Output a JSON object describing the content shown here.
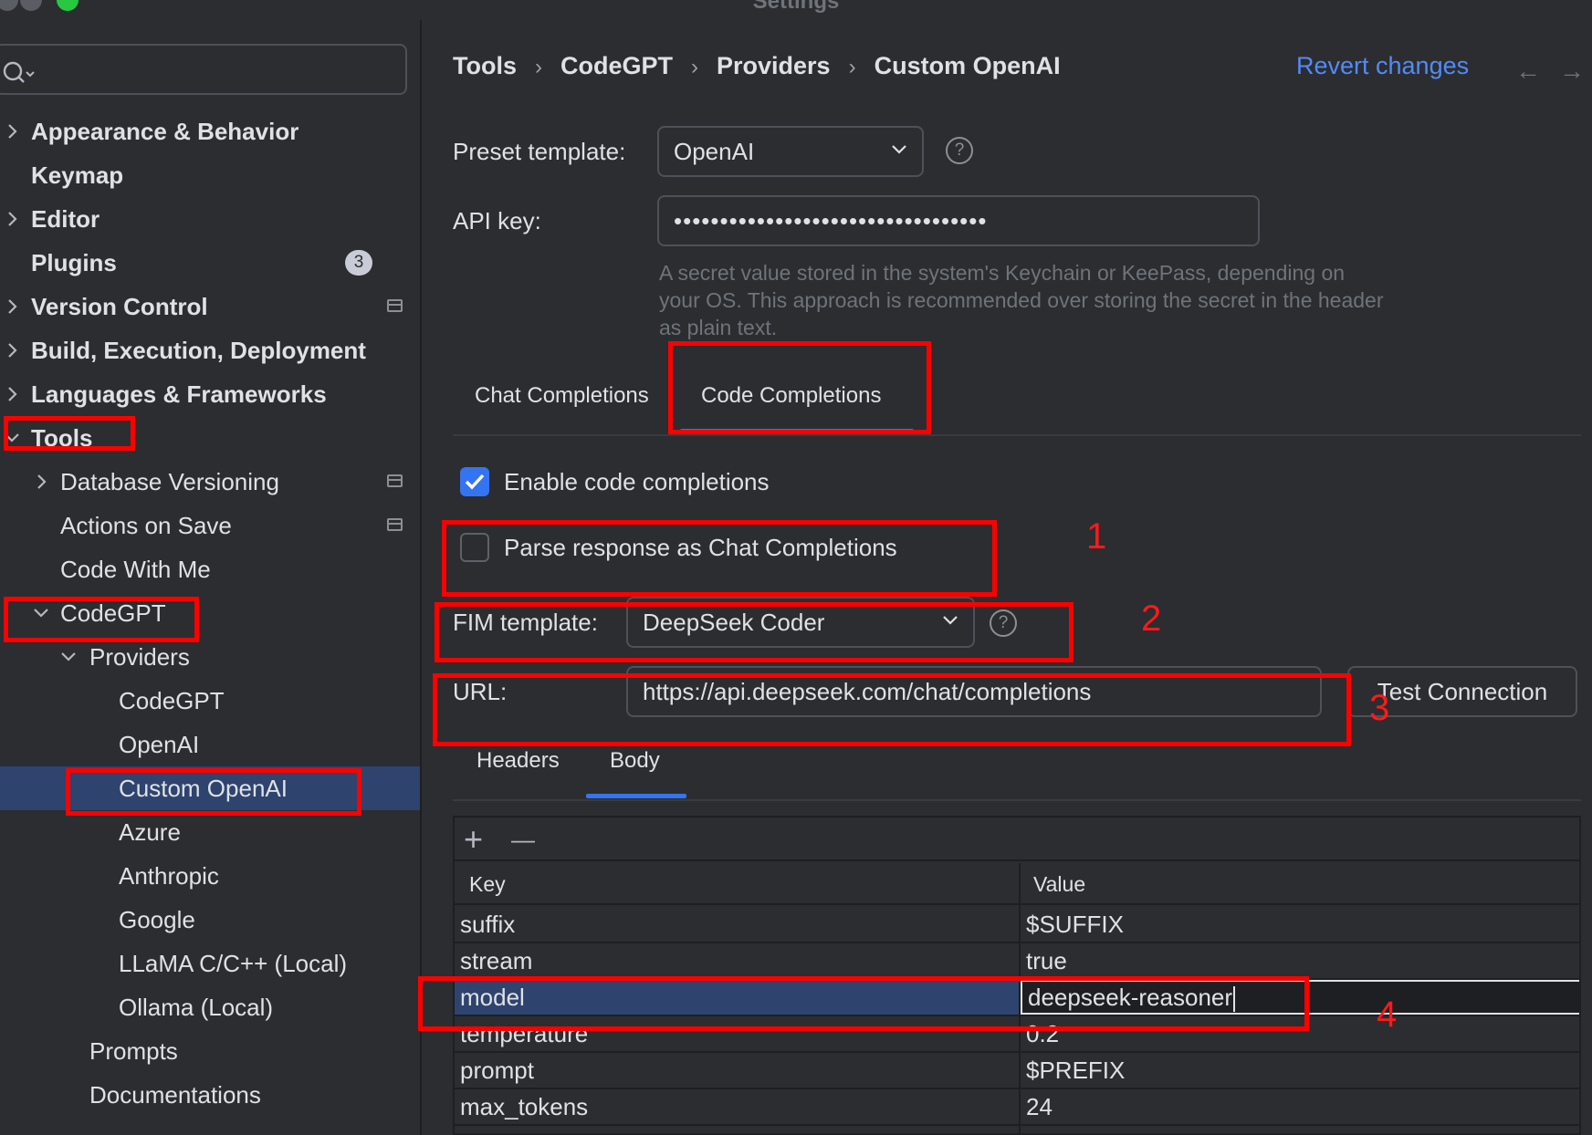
{
  "window": {
    "title": "Settings",
    "traffic_colors": [
      "#5a5d63",
      "#5a5d63",
      "#28c840"
    ]
  },
  "sidebar": {
    "search": {
      "placeholder": ""
    },
    "items": [
      {
        "label": "Appearance & Behavior",
        "bold": true,
        "chevron": "right",
        "depth": 0
      },
      {
        "label": "Keymap",
        "bold": true,
        "chevron": "",
        "depth": 0
      },
      {
        "label": "Editor",
        "bold": true,
        "chevron": "right",
        "depth": 0
      },
      {
        "label": "Plugins",
        "bold": true,
        "chevron": "",
        "depth": 0,
        "badge": "3"
      },
      {
        "label": "Version Control",
        "bold": true,
        "chevron": "right",
        "depth": 0,
        "project_icon": true
      },
      {
        "label": "Build, Execution, Deployment",
        "bold": true,
        "chevron": "right",
        "depth": 0
      },
      {
        "label": "Languages & Frameworks",
        "bold": true,
        "chevron": "right",
        "depth": 0
      },
      {
        "label": "Tools",
        "bold": true,
        "chevron": "down",
        "depth": 0
      },
      {
        "label": "Database Versioning",
        "bold": false,
        "chevron": "right",
        "depth": 1,
        "project_icon": true
      },
      {
        "label": "Actions on Save",
        "bold": false,
        "chevron": "",
        "depth": 1,
        "project_icon": true
      },
      {
        "label": "Code With Me",
        "bold": false,
        "chevron": "",
        "depth": 1
      },
      {
        "label": "CodeGPT",
        "bold": false,
        "chevron": "down",
        "depth": 1
      },
      {
        "label": "Providers",
        "bold": false,
        "chevron": "down",
        "depth": 2
      },
      {
        "label": "CodeGPT",
        "bold": false,
        "chevron": "",
        "depth": 3
      },
      {
        "label": "OpenAI",
        "bold": false,
        "chevron": "",
        "depth": 3
      },
      {
        "label": "Custom OpenAI",
        "bold": false,
        "chevron": "",
        "depth": 3,
        "selected": true
      },
      {
        "label": "Azure",
        "bold": false,
        "chevron": "",
        "depth": 3
      },
      {
        "label": "Anthropic",
        "bold": false,
        "chevron": "",
        "depth": 3
      },
      {
        "label": "Google",
        "bold": false,
        "chevron": "",
        "depth": 3
      },
      {
        "label": "LLaMA C/C++ (Local)",
        "bold": false,
        "chevron": "",
        "depth": 3
      },
      {
        "label": "Ollama (Local)",
        "bold": false,
        "chevron": "",
        "depth": 3
      },
      {
        "label": "Prompts",
        "bold": false,
        "chevron": "",
        "depth": 2
      },
      {
        "label": "Documentations",
        "bold": false,
        "chevron": "",
        "depth": 2
      }
    ]
  },
  "header": {
    "breadcrumbs": [
      "Tools",
      "CodeGPT",
      "Providers",
      "Custom OpenAI"
    ],
    "revert_label": "Revert changes",
    "back_arrow": "←",
    "forward_arrow": "→"
  },
  "form": {
    "preset_label": "Preset template:",
    "preset_value": "OpenAI",
    "api_key_label": "API key:",
    "api_key_value": "••••••••••••••••••••••••••••••••••",
    "api_key_hint": "A secret value stored in the system's Keychain or KeePass, depending on your OS. This approach is recommended over storing the secret in the header as plain text.",
    "help_glyph": "?"
  },
  "tabs": {
    "items": [
      "Chat Completions",
      "Code Completions"
    ],
    "active": "Code Completions"
  },
  "code_completions": {
    "enable_label": "Enable code completions",
    "enable_checked": true,
    "parse_label": "Parse response as Chat Completions",
    "parse_checked": false,
    "fim_label": "FIM template:",
    "fim_value": "DeepSeek Coder",
    "url_label": "URL:",
    "url_value": "https://api.deepseek.com/chat/completions",
    "test_button": "Test Connection"
  },
  "subtabs": {
    "items": [
      "Headers",
      "Body"
    ],
    "active": "Body"
  },
  "body_table": {
    "add_glyph": "+",
    "remove_glyph": "—",
    "columns": [
      "Key",
      "Value"
    ],
    "rows": [
      {
        "key": "suffix",
        "value": "$SUFFIX"
      },
      {
        "key": "stream",
        "value": "true"
      },
      {
        "key": "model",
        "value": "deepseek-reasoner",
        "selected": true,
        "editing": true
      },
      {
        "key": "temperature",
        "value": "0.2"
      },
      {
        "key": "prompt",
        "value": "$PREFIX"
      },
      {
        "key": "max_tokens",
        "value": "24"
      }
    ]
  },
  "annotations": {
    "color": "#ff0000",
    "numbers": [
      "1",
      "2",
      "3",
      "4"
    ]
  }
}
